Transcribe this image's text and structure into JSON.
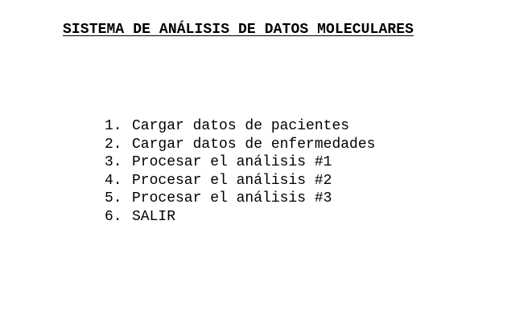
{
  "header": {
    "title": "SISTEMA DE ANÁLISIS DE DATOS MOLECULARES"
  },
  "menu": {
    "items": [
      {
        "number": "1.",
        "label": "Cargar datos de pacientes"
      },
      {
        "number": "2.",
        "label": "Cargar datos de enfermedades"
      },
      {
        "number": "3.",
        "label": "Procesar el análisis #1"
      },
      {
        "number": "4.",
        "label": "Procesar el análisis #2"
      },
      {
        "number": "5.",
        "label": "Procesar el análisis #3"
      },
      {
        "number": "6.",
        "label": "SALIR"
      }
    ]
  }
}
